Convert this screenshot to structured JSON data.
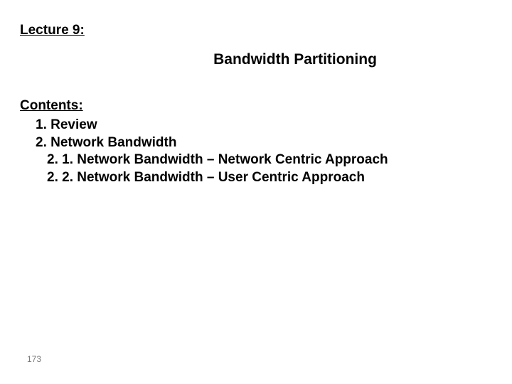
{
  "lecture_label": "Lecture 9:",
  "slide_title": "Bandwidth Partitioning",
  "contents_heading": "Contents:",
  "toc": {
    "item1": "1. Review",
    "item2": "2. Network Bandwidth",
    "item2_1": "2. 1. Network Bandwidth – Network Centric Approach",
    "item2_2": "2. 2. Network Bandwidth – User Centric Approach"
  },
  "page_number": "173"
}
